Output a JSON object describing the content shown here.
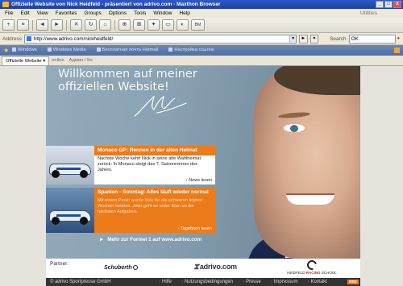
{
  "window": {
    "title": "Offizielle Website von Nick Heidfeld - präsentiert von adrivo.com - Maxthon Browser",
    "minimize": "_",
    "maximize": "□",
    "close": "x"
  },
  "menu": {
    "items": [
      "File",
      "Edit",
      "View",
      "Favorites",
      "Groups",
      "Options",
      "Tools",
      "Window",
      "Help"
    ],
    "utilities": "Utilities"
  },
  "toolbar": {
    "buttons": [
      "+",
      "≡",
      "◄",
      "►",
      "✕",
      "↻",
      "⌂",
      "⊕",
      "⊞",
      "✦",
      "▭",
      "◐"
    ],
    "bm_label": "BM"
  },
  "address": {
    "label": "Address",
    "url": "http://www.adrivo.com/nickheidfeld/",
    "search_label": "Search",
    "search_value": "OK"
  },
  "links": {
    "items": [
      "Windows",
      "Windows Media",
      "Бесплатная почта Hotmail",
      "Настройка ссылок"
    ]
  },
  "tabs": {
    "active": "Offizielle Website",
    "others": [
      "online",
      "Админ / Ко"
    ]
  },
  "page": {
    "welcome_line1": "Willkommen auf meiner",
    "welcome_line2": "offiziellen Website!",
    "news1": {
      "headline": "Monaco GP: Rennen in der alten Heimat",
      "text": "Nächste Woche kehrt Nick in seine alte Wahlheimat zurück: In Monaco steigt das 7. Saisonrennen des Jahres.",
      "more": "News lesen"
    },
    "news2": {
      "headline": "Spanien - Sonntag: Alles läuft wieder normal",
      "text": "Mit einem Punkt wurde Nick für die schweren letzten Wochen belohnt. Jetzt geht es voller Elan an die nächsten Aufgaben.",
      "more": "Tagebuch lesen"
    },
    "formel_link": "Mehr zur Formel 1 auf www.adrivo.com",
    "partner_label": "Partner:",
    "partners": {
      "schuberth": "Schuberth",
      "adrivo": "adrivo.com",
      "heidfeld_a": "HEIDFELD ",
      "heidfeld_b": "RACING",
      "heidfeld_c": " SCHOOL"
    }
  },
  "footer": {
    "copyright": "© adrivo Sportpresse GmbH",
    "links": [
      "Hilfe",
      "Nutzungsbedingungen",
      "Presse",
      "Impressum",
      "Kontakt"
    ],
    "rss": "RSS"
  }
}
